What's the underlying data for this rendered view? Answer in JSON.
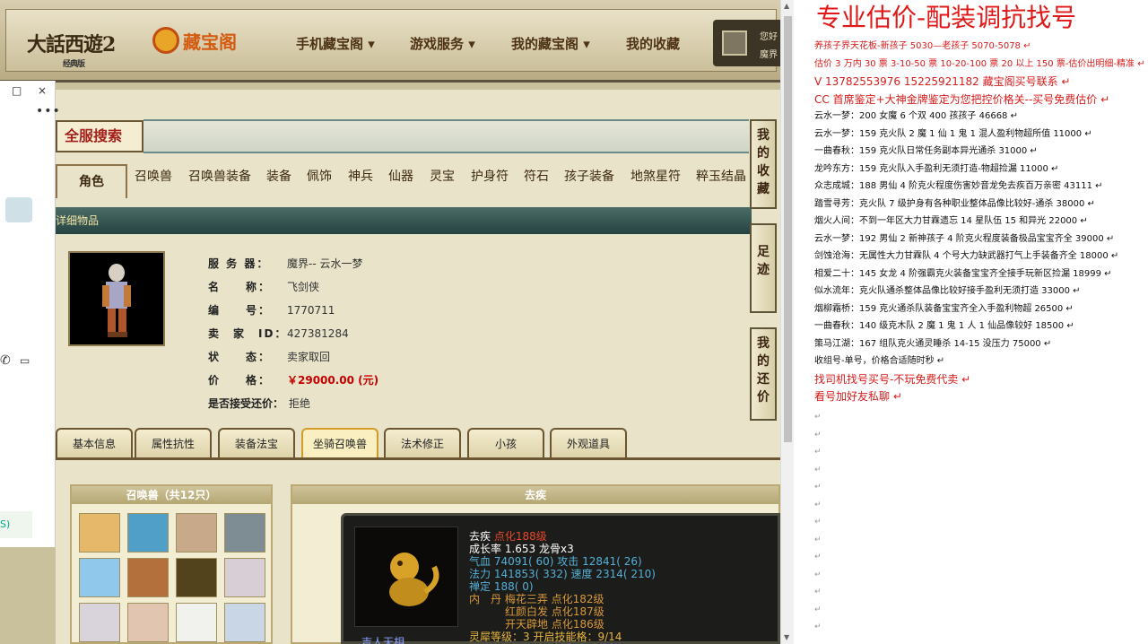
{
  "top_nav": {
    "logo_main": "大話西遊2",
    "logo_sub": "经典版",
    "logo_cbg": "藏宝阁",
    "menu": [
      "手机藏宝阁 ▾",
      "游戏服务 ▾",
      "我的藏宝阁 ▾",
      "我的收藏"
    ],
    "user_line1": "您好",
    "user_line2": "魔界"
  },
  "chat_window": {
    "close": "×",
    "min": "□",
    "more": "•••",
    "side_label": "S)"
  },
  "search": {
    "title": "全服搜索"
  },
  "category_tabs": [
    "角色",
    "召唤兽",
    "召唤兽装备",
    "装备",
    "佩饰",
    "神兵",
    "仙器",
    "灵宝",
    "护身符",
    "符石",
    "孩子装备",
    "地煞星符",
    "粹玉结晶"
  ],
  "band_text": "详细物品",
  "item_info": {
    "server_label": "服 务 器：",
    "server": "魔界-- 云水一梦",
    "name_label": "名　　称：",
    "name": "飞剑侠",
    "id_label": "编　　号：",
    "id": "1770711",
    "seller_label": "卖　家　ID：",
    "seller": "427381284",
    "status_label": "状　　态：",
    "status": "卖家取回",
    "price_label": "价　　格：",
    "price": "￥29000.00 (元)",
    "bargain_label": "是否接受还价：",
    "bargain": "拒绝"
  },
  "right_side_buttons": [
    "我的收藏",
    "足迹",
    "我的还价"
  ],
  "bottom_tabs": [
    "基本信息",
    "属性抗性",
    "装备法宝",
    "坐骑召唤兽",
    "法术修正",
    "小孩",
    "外观道具"
  ],
  "pet_panel": {
    "title": "召唤兽（共12只）"
  },
  "pet_detail": {
    "panel_title": "去疾",
    "name": "去疾",
    "dianhua": "点化188级",
    "growth": "成长率 1.653 龙骨x3",
    "hp": "气血 74091( 60) 攻击 12841( 26)",
    "mp": "法力 141853( 332) 速度 2314( 210)",
    "chanding": "禅定 188( 0)",
    "neidan1": "内　丹 梅花三弄 点化182级",
    "neidan2": "红颜白发 点化187级",
    "neidan3": "开天辟地 点化186级",
    "lingxi": "灵犀等级：3 开启技能格：9/14",
    "bottom_name": "吉人天相"
  },
  "right_doc": {
    "title": "专业估价-配装调抗找号",
    "lines": [
      {
        "t": "养孩子界天花板-新孩子 5030—老孩子 5070-5078",
        "c": "red"
      },
      {
        "t": "估价 3 万内 30 票  3-10-50 票  10-20-100 票 20 以上 150 票-估价出明细-精准",
        "c": "red"
      },
      {
        "t": "V 13782553976    15225921182  藏宝阁买号联系",
        "c": "red",
        "big": true
      },
      {
        "t": "CC 首席鉴定+大神金牌鉴定为您把控价格关--买号免费估价",
        "c": "red",
        "big": true
      },
      {
        "t": "云水一梦：200 女魔 6 个双 400 孩孩子 46668",
        "c": "k"
      },
      {
        "t": "云水一梦：159 克火队 2 魔 1 仙 1 鬼 1 混人盈利物超所值 11000",
        "c": "k"
      },
      {
        "t": "一曲春秋：159 克火队日常任务副本异光通杀 31000",
        "c": "k"
      },
      {
        "t": "龙吟东方：159 克火队入手盈利无须打造-物超捡漏 11000",
        "c": "k"
      },
      {
        "t": "众志成城：188 男仙 4 阶克火程度伤害妙音龙免去疾百万亲密 43111",
        "c": "k"
      },
      {
        "t": "踏雪寻芳：克火队 7 级护身有各种职业整体品像比较好-通杀 38000",
        "c": "k"
      },
      {
        "t": "烟火人间：不到一年区大力甘霖遗忘 14 星队伍 15 和异光 22000",
        "c": "k"
      },
      {
        "t": "云水一梦：192 男仙 2 新神孩子 4 阶克火程度装备极品宝宝齐全 39000",
        "c": "k"
      },
      {
        "t": "剑蚀沧海：无属性大力甘霖队 4 个号大力缺武器打气上手装备齐全 18000",
        "c": "k"
      },
      {
        "t": "相爱二十：145 女龙 4 阶强霸克火装备宝宝齐全接手玩新区捡漏 18999",
        "c": "k"
      },
      {
        "t": "似水流年：克火队通杀整体品像比较好接手盈利无须打造 33000",
        "c": "k"
      },
      {
        "t": "烟柳霜桥：159 克火通杀队装备宝宝齐全入手盈利物超 26500",
        "c": "k"
      },
      {
        "t": "一曲春秋：140 级克木队 2 魔 1 鬼 1 人 1 仙品像较好 18500",
        "c": "k"
      },
      {
        "t": "策马江湖：167 组队克火通灵睡杀 14-15 没压力 75000",
        "c": "k"
      },
      {
        "t": "收组号-单号，价格合适随时秒",
        "c": "k"
      },
      {
        "t": "找司机找号买号-不玩免费代卖",
        "c": "red",
        "big": true
      },
      {
        "t": "看号加好友私聊",
        "c": "red",
        "big": true
      }
    ],
    "return_mark": "↵"
  }
}
